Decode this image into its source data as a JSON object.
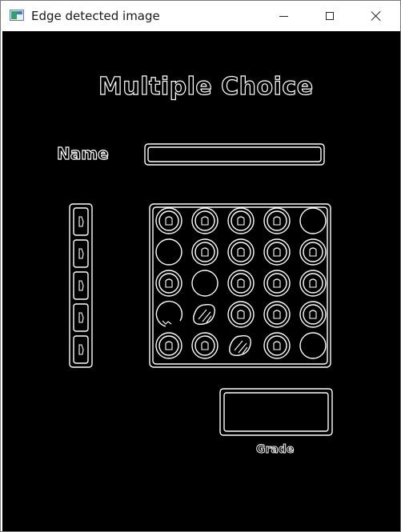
{
  "window": {
    "title": "Edge detected image",
    "controls": {
      "minimize": "minimize",
      "maximize": "maximize",
      "close": "close"
    }
  },
  "image": {
    "heading": "Multiple Choice",
    "name_label": "Name",
    "grade_label": "Grade",
    "question_count": 5,
    "option_count": 5,
    "answer_grid": [
      [
        "filled",
        "filled",
        "filled",
        "filled",
        "empty"
      ],
      [
        "empty",
        "filled",
        "filled",
        "filled",
        "filled"
      ],
      [
        "filled",
        "empty",
        "filled",
        "filled",
        "filled"
      ],
      [
        "broken",
        "scribble",
        "filled",
        "filled",
        "filled"
      ],
      [
        "filled",
        "filled",
        "scribble",
        "filled",
        "empty"
      ]
    ],
    "colors": {
      "background": "#000000",
      "edge": "#ffffff"
    }
  }
}
